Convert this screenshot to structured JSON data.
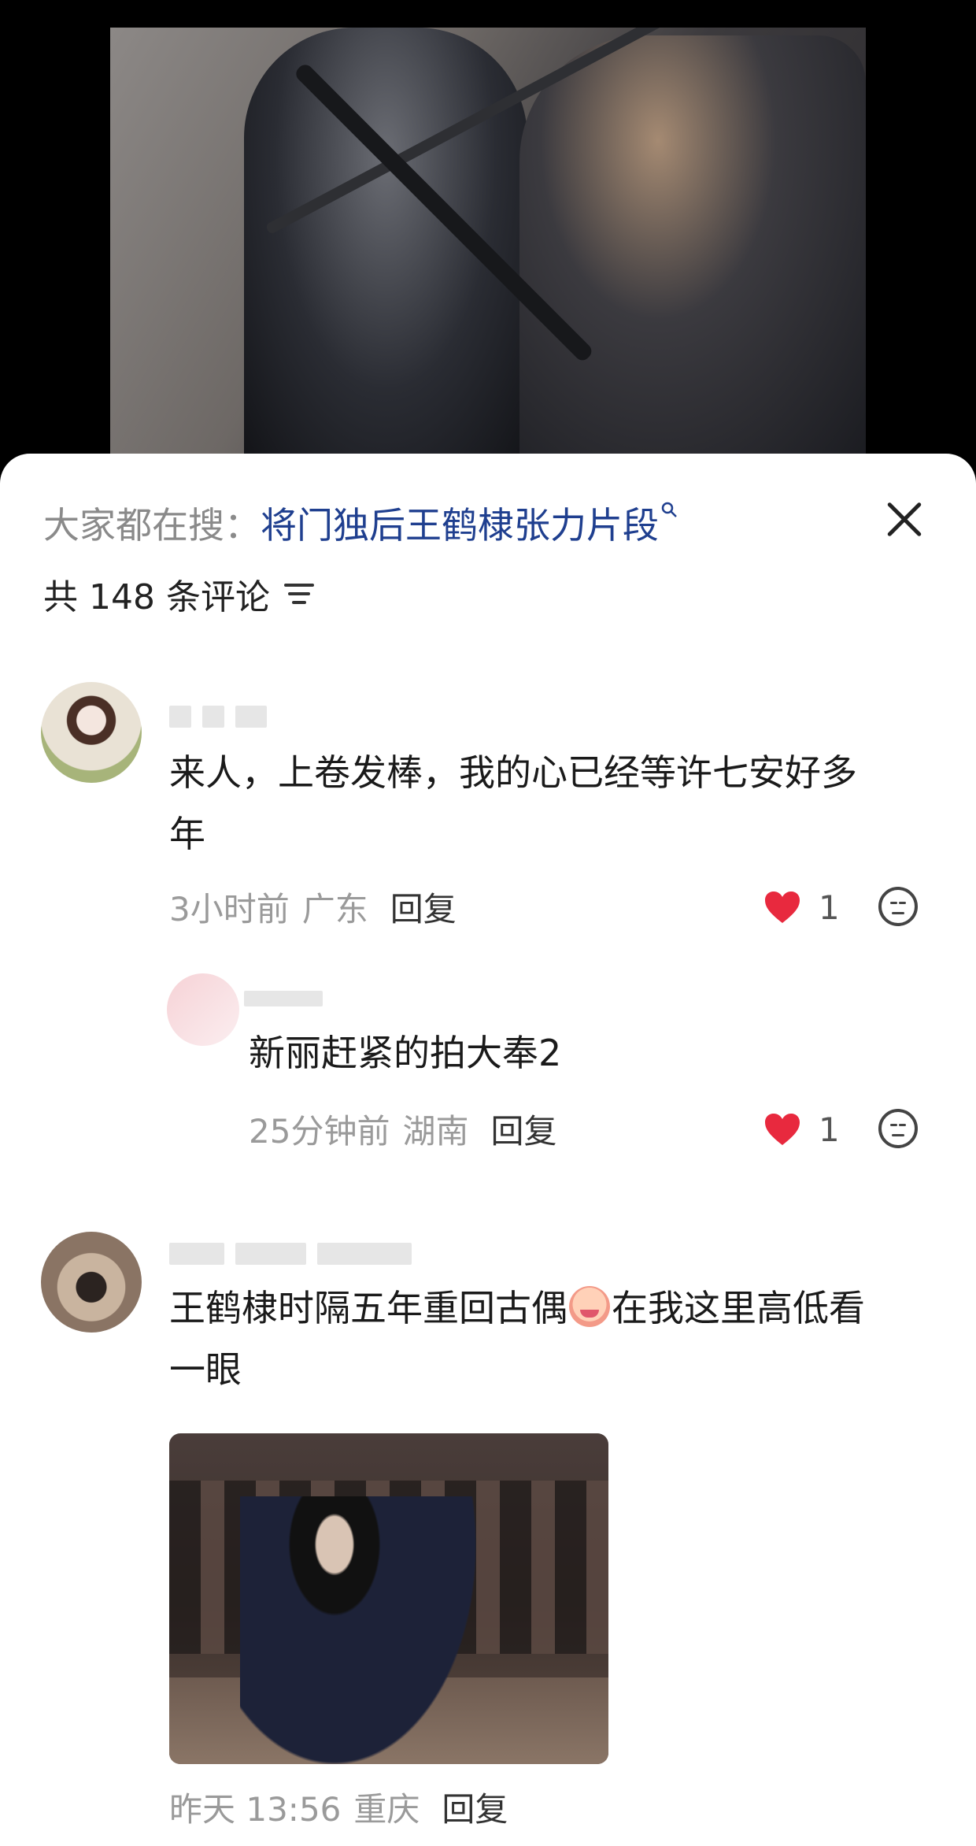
{
  "search": {
    "prefix": "大家都在搜：",
    "query": "将门独后王鹤棣张力片段",
    "search_icon": "search-icon"
  },
  "close_icon": "close-icon",
  "comments_header": {
    "count_label": "共 148 条评论",
    "filter_icon": "filter-icon"
  },
  "comments": [
    {
      "text_line1": "来人，上卷发棒，我的心已经等许七安好多",
      "text_line2": "年",
      "time": "3小时前",
      "location": "广东",
      "reply_label": "回复",
      "likes": "1"
    },
    {
      "text": "新丽赶紧的拍大奉2",
      "time": "25分钟前",
      "location": "湖南",
      "reply_label": "回复",
      "likes": "1"
    },
    {
      "text_part1": "王鹤棣时隔五年重回古偶",
      "text_part2": "在我这里高低看",
      "text_line2": "一眼",
      "emoji": "crying-emoji",
      "time": "昨天 13:56",
      "location": "重庆",
      "reply_label": "回复"
    }
  ],
  "colors": {
    "link": "#1f3f8f",
    "heart": "#e8293e",
    "meta": "#9a9a9a"
  }
}
